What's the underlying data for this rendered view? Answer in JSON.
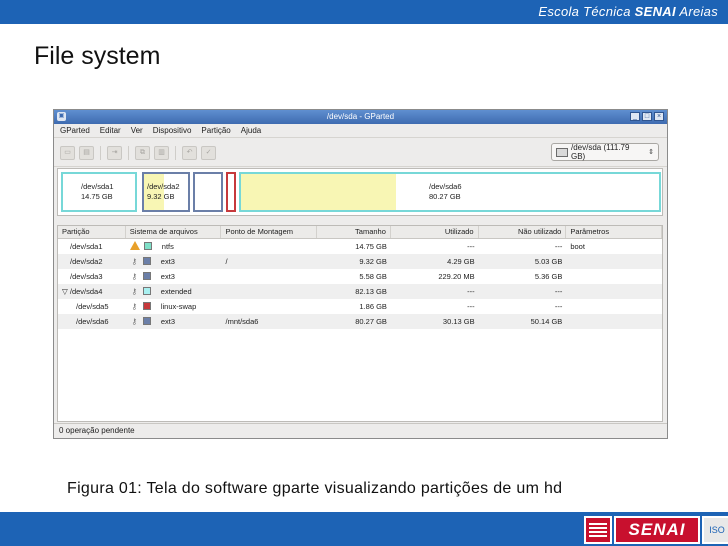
{
  "slide": {
    "school_prefix": "Escola Técnica",
    "school_brand": "SENAI",
    "school_suffix": "Areias",
    "title": "File system",
    "caption": "Figura 01: Tela do software gparte visualizando partições de um hd",
    "footer_logo_text": "SENAI",
    "footer_iso": "ISO",
    "band_color": "#1d63b5",
    "logo_color": "#c8102e"
  },
  "window": {
    "title": "/dev/sda - GParted",
    "menu": [
      "GParted",
      "Editar",
      "Ver",
      "Dispositivo",
      "Partição",
      "Ajuda"
    ],
    "toolbar_icons": [
      "new-icon",
      "delete-icon",
      "resize-icon",
      "copy-icon",
      "paste-icon",
      "undo-icon",
      "apply-icon"
    ],
    "device_selector": "/dev/sda  (111.79 GB)",
    "statusbar": "0 operação pendente"
  },
  "disk_map": [
    {
      "name": "/dev/sda1",
      "size": "14.75 GB",
      "border": "#77d8d8",
      "fill": "#ffffff",
      "used_fraction": 0
    },
    {
      "name": "/dev/sda2",
      "size": "9.32 GB",
      "border": "#6b7fa8",
      "fill": "#f8f6b4",
      "used_fraction": 0.46
    },
    {
      "name": "",
      "size": "",
      "border": "#6b7fa8",
      "fill": "#ffffff",
      "used_fraction": 0
    },
    {
      "name": "",
      "size": "",
      "border": "#c6393c",
      "fill": "#ffffff",
      "used_fraction": 0
    },
    {
      "name": "/dev/sda6",
      "size": "80.27 GB",
      "border": "#77d8d8",
      "fill": "#f8f6b4",
      "used_fraction": 0.37
    }
  ],
  "columns": [
    "Partição",
    "Sistema de arquivos",
    "Ponto de Montagem",
    "Tamanho",
    "Utilizado",
    "Não utilizado",
    "Parâmetros"
  ],
  "rows": [
    {
      "partition": "/dev/sda1",
      "icon": "warning-icon",
      "fs": "ntfs",
      "fs_color": "#7fe0c8",
      "mount": "",
      "size": "14.75 GB",
      "used": "---",
      "unused": "---",
      "flags": "boot"
    },
    {
      "partition": "/dev/sda2",
      "icon": "key-icon",
      "fs": "ext3",
      "fs_color": "#6b7fa8",
      "mount": "/",
      "size": "9.32 GB",
      "used": "4.29 GB",
      "unused": "5.03 GB",
      "flags": ""
    },
    {
      "partition": "/dev/sda3",
      "icon": "key-icon",
      "fs": "ext3",
      "fs_color": "#6b7fa8",
      "mount": "",
      "size": "5.58 GB",
      "used": "229.20 MB",
      "unused": "5.36 GB",
      "flags": ""
    },
    {
      "partition": "/dev/sda4",
      "icon": "key-icon",
      "fs": "extended",
      "fs_color": "#a8f0f0",
      "mount": "",
      "size": "82.13 GB",
      "used": "---",
      "unused": "---",
      "flags": ""
    },
    {
      "partition": "/dev/sda5",
      "icon": "key-icon",
      "fs": "linux-swap",
      "fs_color": "#c6393c",
      "mount": "",
      "size": "1.86 GB",
      "used": "---",
      "unused": "---",
      "flags": ""
    },
    {
      "partition": "/dev/sda6",
      "icon": "key-icon",
      "fs": "ext3",
      "fs_color": "#6b7fa8",
      "mount": "/mnt/sda6",
      "size": "80.27 GB",
      "used": "30.13 GB",
      "unused": "50.14 GB",
      "flags": ""
    }
  ]
}
